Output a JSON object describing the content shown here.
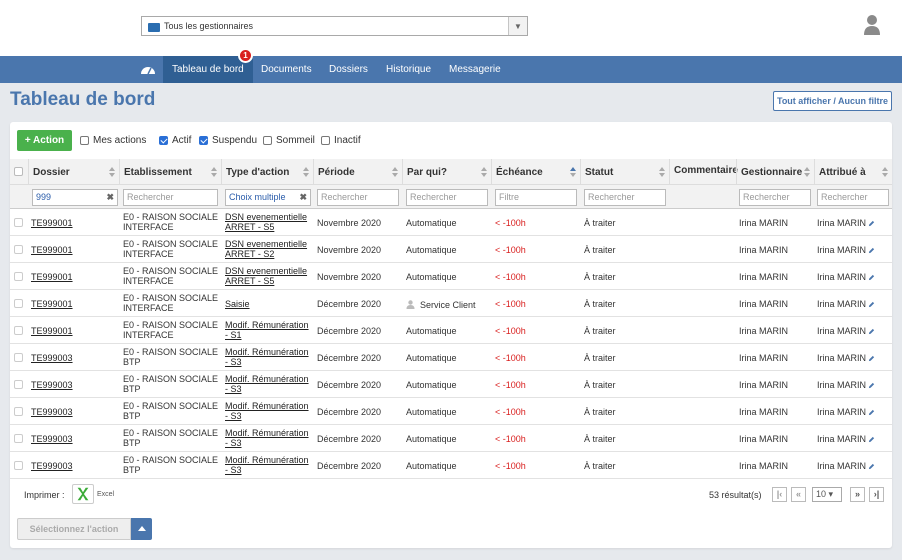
{
  "header": {
    "gestionnaire_select": "Tous les gestionnaires",
    "icons": {
      "folder": "folder-icon",
      "user": "user-icon",
      "dropdown": "chevron-down-icon"
    }
  },
  "nav": {
    "items": [
      "Tableau de bord",
      "Documents",
      "Dossiers",
      "Historique",
      "Messagerie"
    ],
    "active": "Tableau de bord",
    "badge": "1",
    "home_icon": "dashboard-gauge-icon"
  },
  "page": {
    "title": "Tableau de bord",
    "filter_button": "Tout afficher / Aucun filtre"
  },
  "toolbar": {
    "action_button": "+ Action",
    "checkboxes": [
      {
        "label": "Mes actions",
        "checked": false
      },
      {
        "label": "Actif",
        "checked": true
      },
      {
        "label": "Suspendu",
        "checked": true
      },
      {
        "label": "Sommeil",
        "checked": false
      },
      {
        "label": "Inactif",
        "checked": false
      }
    ]
  },
  "table": {
    "columns": [
      "Dossier",
      "Etablissement",
      "Type d'action",
      "Période",
      "Par qui?",
      "Échéance",
      "Statut",
      "Commentaire",
      "Gestionnaire",
      "Attribué à"
    ],
    "filters": {
      "dossier": "999",
      "etablissement": "Rechercher",
      "type_action": "Choix multiple",
      "periode": "Rechercher",
      "par_qui": "Rechercher",
      "echeance": "Filtre",
      "statut": "Rechercher",
      "gestionnaire": "Rechercher",
      "attribue": "Rechercher"
    },
    "rows": [
      {
        "dossier": "TE999001",
        "etab1": "E0 - RAISON SOCIALE",
        "etab2": "INTERFACE",
        "type1": "DSN evenementielle",
        "type2": "ARRET - S5",
        "periode": "Novembre 2020",
        "par_qui": "Automatique",
        "echeance": "< -100h",
        "statut": "À traiter",
        "gestionnaire": "Irina MARIN",
        "attribue": "Irina MARIN"
      },
      {
        "dossier": "TE999001",
        "etab1": "E0 - RAISON SOCIALE",
        "etab2": "INTERFACE",
        "type1": "DSN evenementielle",
        "type2": "ARRET - S2",
        "periode": "Novembre 2020",
        "par_qui": "Automatique",
        "echeance": "< -100h",
        "statut": "À traiter",
        "gestionnaire": "Irina MARIN",
        "attribue": "Irina MARIN"
      },
      {
        "dossier": "TE999001",
        "etab1": "E0 - RAISON SOCIALE",
        "etab2": "INTERFACE",
        "type1": "DSN evenementielle",
        "type2": "ARRET - S5",
        "periode": "Novembre 2020",
        "par_qui": "Automatique",
        "echeance": "< -100h",
        "statut": "À traiter",
        "gestionnaire": "Irina MARIN",
        "attribue": "Irina MARIN"
      },
      {
        "dossier": "TE999001",
        "etab1": "E0 - RAISON SOCIALE",
        "etab2": "INTERFACE",
        "type1": "Saisie",
        "type2": "",
        "periode": "Décembre 2020",
        "par_qui": "Service Client",
        "par_qui_icon": "person-icon",
        "echeance": "< -100h",
        "statut": "À traiter",
        "gestionnaire": "Irina MARIN",
        "attribue": "Irina MARIN"
      },
      {
        "dossier": "TE999001",
        "etab1": "E0 - RAISON SOCIALE",
        "etab2": "INTERFACE",
        "type1": "Modif. Rémunération",
        "type2": "- S1",
        "periode": "Décembre 2020",
        "par_qui": "Automatique",
        "echeance": "< -100h",
        "statut": "À traiter",
        "gestionnaire": "Irina MARIN",
        "attribue": "Irina MARIN"
      },
      {
        "dossier": "TE999003",
        "etab1": "E0 - RAISON SOCIALE",
        "etab2": "BTP",
        "type1": "Modif. Rémunération",
        "type2": "- S3",
        "periode": "Décembre 2020",
        "par_qui": "Automatique",
        "echeance": "< -100h",
        "statut": "À traiter",
        "gestionnaire": "Irina MARIN",
        "attribue": "Irina MARIN"
      },
      {
        "dossier": "TE999003",
        "etab1": "E0 - RAISON SOCIALE",
        "etab2": "BTP",
        "type1": "Modif. Rémunération",
        "type2": "- S3",
        "periode": "Décembre 2020",
        "par_qui": "Automatique",
        "echeance": "< -100h",
        "statut": "À traiter",
        "gestionnaire": "Irina MARIN",
        "attribue": "Irina MARIN"
      },
      {
        "dossier": "TE999003",
        "etab1": "E0 - RAISON SOCIALE",
        "etab2": "BTP",
        "type1": "Modif. Rémunération",
        "type2": "- S3",
        "periode": "Décembre 2020",
        "par_qui": "Automatique",
        "echeance": "< -100h",
        "statut": "À traiter",
        "gestionnaire": "Irina MARIN",
        "attribue": "Irina MARIN"
      },
      {
        "dossier": "TE999003",
        "etab1": "E0 - RAISON SOCIALE",
        "etab2": "BTP",
        "type1": "Modif. Rémunération",
        "type2": "- S3",
        "periode": "Décembre 2020",
        "par_qui": "Automatique",
        "echeance": "< -100h",
        "statut": "À traiter",
        "gestionnaire": "Irina MARIN",
        "attribue": "Irina MARIN"
      },
      {
        "dossier": "TE999003",
        "etab1": "E0 - RAISON SOCIALE",
        "etab2": "BTP",
        "type1": "Modif. Rémunération",
        "type2": "- S3",
        "periode": "Décembre 2020",
        "par_qui": "Automatique",
        "echeance": "< -100h",
        "statut": "À traiter",
        "gestionnaire": "Irina MARIN",
        "attribue": "Irina MARIN"
      }
    ]
  },
  "footer": {
    "print_label": "Imprimer :",
    "excel_label": "Excel",
    "excel_icon": "excel-icon",
    "results": "53 résultat(s)",
    "page_size": "10",
    "select_action": "Sélectionnez l'action"
  },
  "colors": {
    "nav": "#4a76ad",
    "nav_active": "#2f5f93",
    "green": "#4ab14c",
    "red": "#d9201f",
    "title": "#4a76ad"
  }
}
